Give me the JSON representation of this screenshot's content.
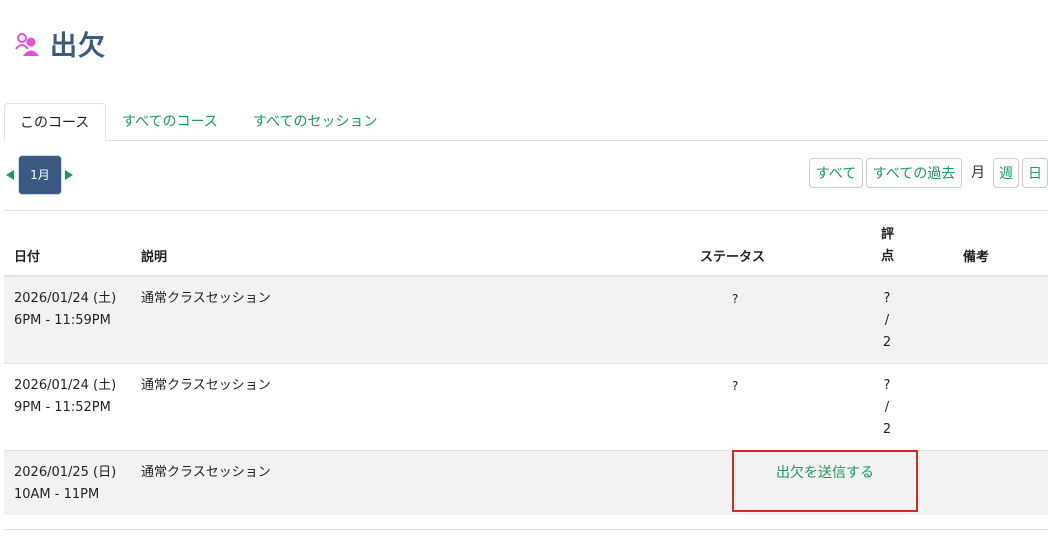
{
  "header": {
    "title": "出欠",
    "icon": "attendance-users-icon",
    "icon_color": "#e052d4"
  },
  "tabs": [
    "このコース",
    "すべてのコース",
    "すべてのセッション"
  ],
  "nav": {
    "current_month": "1月"
  },
  "filters": {
    "all": "すべて",
    "all_past": "すべての過去",
    "month": "月",
    "week": "週",
    "day": "日"
  },
  "table": {
    "headers": {
      "date": "日付",
      "description": "説明",
      "status": "ステータス",
      "grade": "評点",
      "remarks": "備考"
    },
    "rows": [
      {
        "date": "2026/01/24 (土)",
        "time": "6PM - 11:59PM",
        "description": "通常クラスセッション",
        "status": "?",
        "grade": [
          "?",
          "/",
          "2"
        ]
      },
      {
        "date": "2026/01/24 (土)",
        "time": "9PM - 11:52PM",
        "description": "通常クラスセッション",
        "status": "?",
        "grade": [
          "?",
          "/",
          "2"
        ]
      },
      {
        "date": "2026/01/25 (日)",
        "time": "10AM - 11PM",
        "description": "通常クラスセッション",
        "action": "出欠を送信する"
      }
    ]
  },
  "colors": {
    "accent": "#1a9a62",
    "title": "#3a5a82",
    "highlight": "#d9262b"
  }
}
